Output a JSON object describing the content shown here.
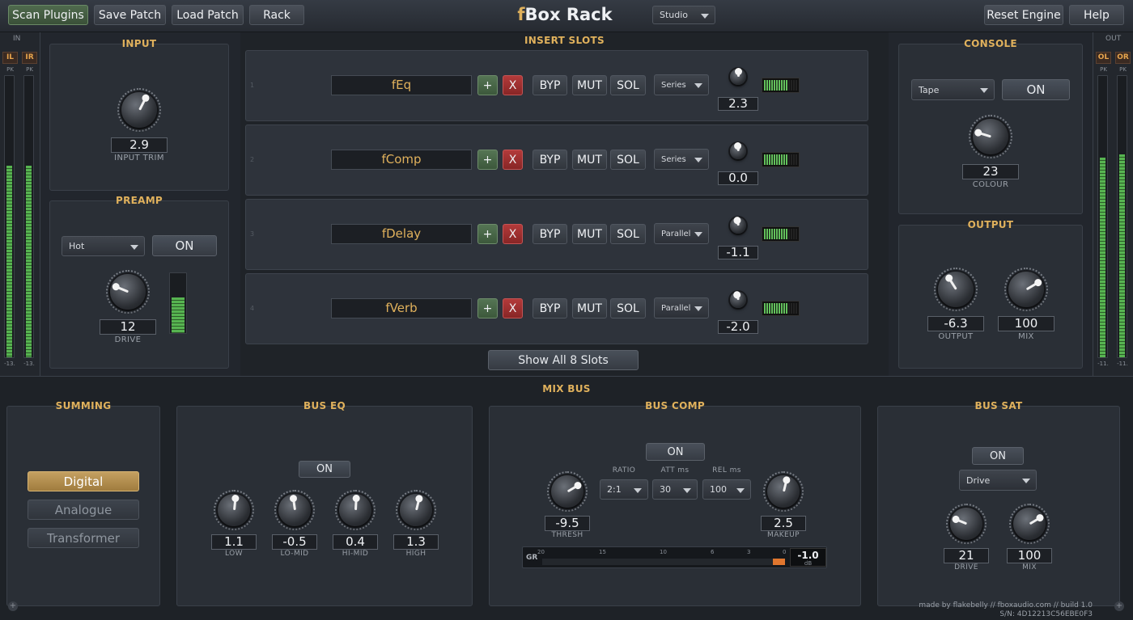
{
  "toolbar": {
    "scan": "Scan Plugins",
    "save": "Save Patch",
    "load": "Load Patch",
    "rack": "Rack",
    "title_prefix": "f",
    "title_rest": "Box Rack",
    "preset": "Studio",
    "reset": "Reset Engine",
    "help": "Help"
  },
  "meters_in": {
    "header": "IN",
    "left": {
      "label": "IL",
      "pk": "PK",
      "readout": "-13.",
      "level": 0.68
    },
    "right": {
      "label": "IR",
      "pk": "PK",
      "readout": "-13.",
      "level": 0.68
    }
  },
  "meters_out": {
    "header": "OUT",
    "left": {
      "label": "OL",
      "pk": "PK",
      "readout": "-11.",
      "level": 0.71
    },
    "right": {
      "label": "OR",
      "pk": "PK",
      "readout": "-11.",
      "level": 0.72
    }
  },
  "input": {
    "title": "INPUT",
    "value": "2.9",
    "label": "INPUT TRIM",
    "knob_pos": 0.6
  },
  "preamp": {
    "title": "PREAMP",
    "mode": "Hot",
    "on": "ON",
    "value": "12",
    "label": "DRIVE",
    "knob_pos": 0.25,
    "meter_level": 0.6
  },
  "inserts": {
    "title": "INSERT SLOTS",
    "slots": [
      {
        "num": "1",
        "name": "fEq",
        "add": "+",
        "remove": "X",
        "byp": "BYP",
        "mut": "MUT",
        "sol": "SOL",
        "routing": "Series",
        "value": "2.3",
        "knob_pos": 0.5,
        "level": 0.72
      },
      {
        "num": "2",
        "name": "fComp",
        "add": "+",
        "remove": "X",
        "byp": "BYP",
        "mut": "MUT",
        "sol": "SOL",
        "routing": "Series",
        "value": "0.0",
        "knob_pos": 0.47,
        "level": 0.72
      },
      {
        "num": "3",
        "name": "fDelay",
        "add": "+",
        "remove": "X",
        "byp": "BYP",
        "mut": "MUT",
        "sol": "SOL",
        "routing": "Parallel",
        "value": "-1.1",
        "knob_pos": 0.45,
        "level": 0.72
      },
      {
        "num": "4",
        "name": "fVerb",
        "add": "+",
        "remove": "X",
        "byp": "BYP",
        "mut": "MUT",
        "sol": "SOL",
        "routing": "Parallel",
        "value": "-2.0",
        "knob_pos": 0.44,
        "level": 0.68
      }
    ],
    "show_all": "Show All 8 Slots"
  },
  "console": {
    "title": "CONSOLE",
    "mode": "Tape",
    "on": "ON",
    "value": "23",
    "label": "COLOUR",
    "knob_pos": 0.23
  },
  "output": {
    "title": "OUTPUT",
    "knobs": [
      {
        "value": "-6.3",
        "label": "OUTPUT",
        "knob_pos": 0.38
      },
      {
        "value": "100",
        "label": "MIX",
        "knob_pos": 0.72
      }
    ]
  },
  "mixbus": {
    "title": "MIX BUS"
  },
  "summing": {
    "title": "SUMMING",
    "options": [
      "Digital",
      "Analogue",
      "Transformer"
    ],
    "selected": "Digital"
  },
  "buseq": {
    "title": "BUS EQ",
    "on": "ON",
    "bands": [
      {
        "value": "1.1",
        "label": "LOW",
        "knob_pos": 0.52
      },
      {
        "value": "-0.5",
        "label": "LO-MID",
        "knob_pos": 0.47
      },
      {
        "value": "0.4",
        "label": "HI-MID",
        "knob_pos": 0.51
      },
      {
        "value": "1.3",
        "label": "HIGH",
        "knob_pos": 0.55
      }
    ]
  },
  "buscomp": {
    "title": "BUS COMP",
    "on": "ON",
    "thresh": {
      "value": "-9.5",
      "label": "THRESH",
      "knob_pos": 0.72
    },
    "ratio": {
      "label": "RATIO",
      "value": "2:1"
    },
    "attack": {
      "label": "ATT ms",
      "value": "30"
    },
    "release": {
      "label": "REL ms",
      "value": "100"
    },
    "makeup": {
      "value": "2.5",
      "label": "MAKEUP",
      "knob_pos": 0.55
    },
    "gr": {
      "label": "GR",
      "scale": [
        "20",
        "15",
        "10",
        "6",
        "3",
        "0"
      ],
      "value": "-1.0",
      "unit": "dB",
      "level": 0.05
    }
  },
  "bussat": {
    "title": "BUS SAT",
    "on": "ON",
    "mode": "Drive",
    "knobs": [
      {
        "value": "21",
        "label": "DRIVE",
        "knob_pos": 0.25
      },
      {
        "value": "100",
        "label": "MIX",
        "knob_pos": 0.72
      }
    ]
  },
  "footer": {
    "credit": "made by flakebelly // fboxaudio.com // build 1.0",
    "serial": "S/N: 4D12213C56EBE0F3"
  }
}
